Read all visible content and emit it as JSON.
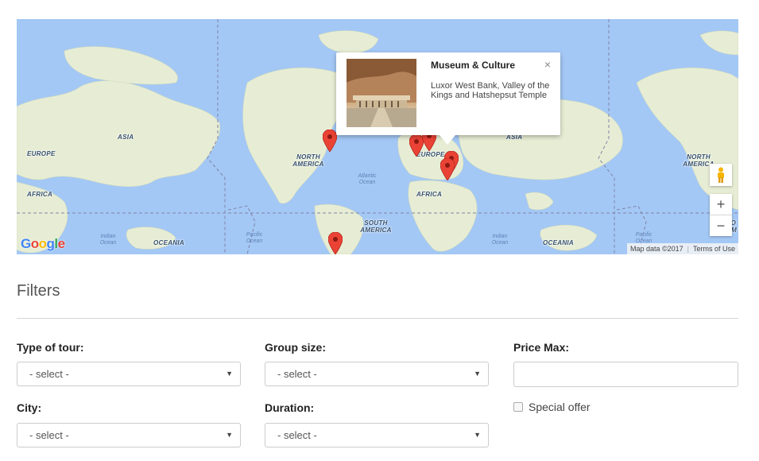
{
  "map": {
    "continent_labels": {
      "asia_left": "ASIA",
      "europe_left": "EUROPE",
      "africa_left": "AFRICA",
      "north_america": "NORTH AMERICA",
      "europe_center": "EUROPE",
      "africa_center": "AFRICA",
      "south_america": "SOUTH AMERICA",
      "asia_right": "ASIA",
      "oceania_left": "OCEANIA",
      "oceania_right": "OCEANIA",
      "north_america_right": "NORTH AMERICA",
      "south_america_edge": "SO AM"
    },
    "ocean_labels": {
      "indian_left": "Indian Ocean",
      "pacific_left": "Pacific Ocean",
      "atlantic": "Atlantic Ocean",
      "indian_right": "Indian Ocean",
      "pacific_right": "Pacific Ocean"
    },
    "footer": {
      "map_data": "Map data ©2017",
      "terms": "Terms of Use"
    },
    "zoom_in_label": "+",
    "zoom_out_label": "−",
    "close_symbol": "×",
    "infowindow": {
      "title": "Museum & Culture",
      "description": "Luxor West Bank, Valley of the Kings and Hatshepsut Temple"
    },
    "colors": {
      "water": "#a4c8f5",
      "land": "#e7edd4",
      "marker": "#ea4335"
    }
  },
  "filters": {
    "title": "Filters",
    "type_of_tour": {
      "label": "Type of tour:",
      "value": "- select -"
    },
    "group_size": {
      "label": "Group size:",
      "value": "- select -"
    },
    "price_max": {
      "label": "Price Max:",
      "value": ""
    },
    "city": {
      "label": "City:",
      "value": "- select -"
    },
    "duration": {
      "label": "Duration:",
      "value": "- select -"
    },
    "special_offer": {
      "label": "Special offer",
      "checked": false
    }
  }
}
